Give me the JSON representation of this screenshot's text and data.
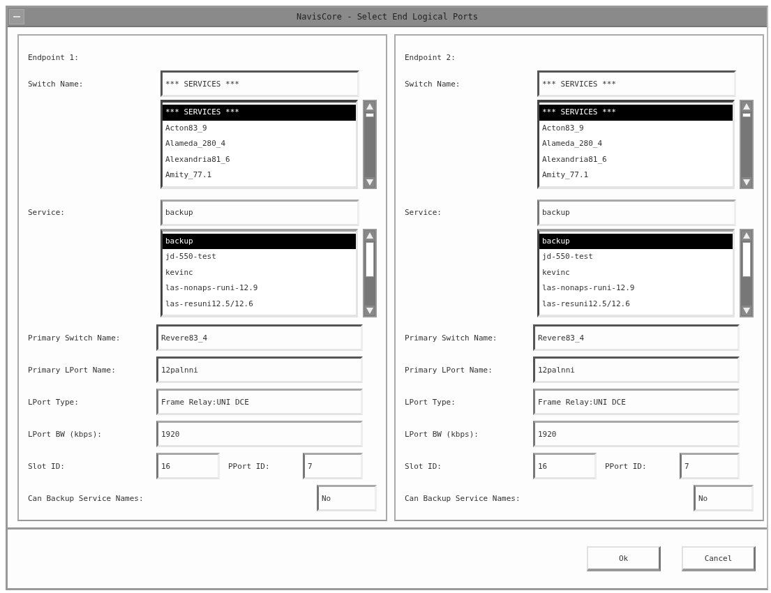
{
  "window": {
    "title": "NavisCore - Select End Logical Ports"
  },
  "endpoints": [
    {
      "heading": "Endpoint 1:",
      "switch_name": {
        "label": "Switch Name:",
        "value": "*** SERVICES ***",
        "options": [
          {
            "text": "*** SERVICES ***",
            "selected": true
          },
          {
            "text": "Acton83_9",
            "selected": false
          },
          {
            "text": "Alameda_280_4",
            "selected": false
          },
          {
            "text": "Alexandria81_6",
            "selected": false
          },
          {
            "text": "Amity_77.1",
            "selected": false
          }
        ]
      },
      "service": {
        "label": "Service:",
        "value": "backup",
        "options": [
          {
            "text": "backup",
            "selected": true
          },
          {
            "text": "jd-550-test",
            "selected": false
          },
          {
            "text": "kevinc",
            "selected": false
          },
          {
            "text": "las-nonaps-runi-12.9",
            "selected": false
          },
          {
            "text": "las-resuni12.5/12.6",
            "selected": false
          }
        ]
      },
      "fields": [
        {
          "label": "Primary Switch Name:",
          "value": "Revere83_4"
        },
        {
          "label": "Primary LPort Name:",
          "value": "12palnni"
        },
        {
          "label": "LPort Type:",
          "value": "Frame Relay:UNI DCE"
        },
        {
          "label": "LPort BW (kbps):",
          "value": "1920"
        }
      ],
      "slot_id": {
        "label": "Slot ID:",
        "value": "16"
      },
      "pport_id": {
        "label": "PPort ID:",
        "value": "7"
      },
      "backup_service_names": {
        "label": "Can Backup Service Names:",
        "value": "No"
      }
    },
    {
      "heading": "Endpoint 2:",
      "switch_name": {
        "label": "Switch Name:",
        "value": "*** SERVICES ***",
        "options": [
          {
            "text": "*** SERVICES ***",
            "selected": true
          },
          {
            "text": "Acton83_9",
            "selected": false
          },
          {
            "text": "Alameda_280_4",
            "selected": false
          },
          {
            "text": "Alexandria81_6",
            "selected": false
          },
          {
            "text": "Amity_77.1",
            "selected": false
          }
        ]
      },
      "service": {
        "label": "Service:",
        "value": "backup",
        "options": [
          {
            "text": "backup",
            "selected": true
          },
          {
            "text": "jd-550-test",
            "selected": false
          },
          {
            "text": "kevinc",
            "selected": false
          },
          {
            "text": "las-nonaps-runi-12.9",
            "selected": false
          },
          {
            "text": "las-resuni12.5/12.6",
            "selected": false
          }
        ]
      },
      "fields": [
        {
          "label": "Primary Switch Name:",
          "value": "Revere83_4"
        },
        {
          "label": "Primary LPort Name:",
          "value": "12palnni"
        },
        {
          "label": "LPort Type:",
          "value": "Frame Relay:UNI DCE"
        },
        {
          "label": "LPort BW (kbps):",
          "value": "1920"
        }
      ],
      "slot_id": {
        "label": "Slot ID:",
        "value": "16"
      },
      "pport_id": {
        "label": "PPort ID:",
        "value": "7"
      },
      "backup_service_names": {
        "label": "Can Backup Service Names:",
        "value": "No"
      }
    }
  ],
  "buttons": [
    "Ok",
    "Cancel"
  ]
}
